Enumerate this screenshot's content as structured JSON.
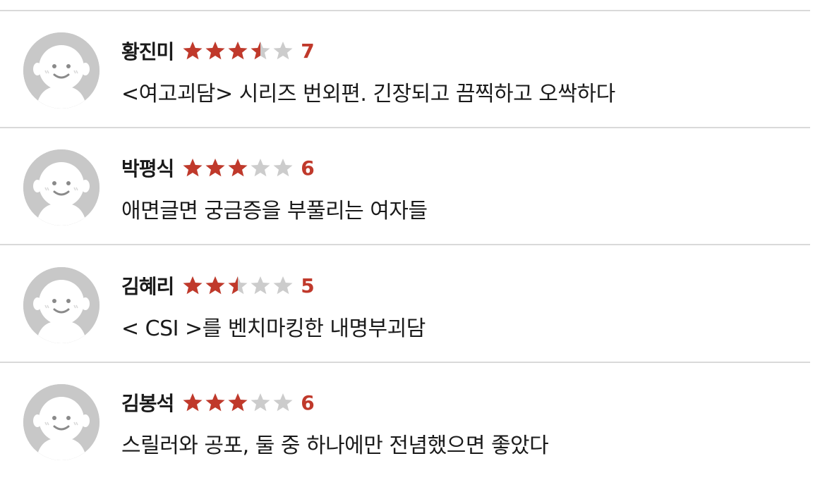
{
  "colors": {
    "star_filled": "#c0392b",
    "star_empty": "#cccccc",
    "score": "#c0392b",
    "avatar_bg": "#c8c8c8",
    "divider": "#d9d9d9"
  },
  "icons": {
    "avatar": "default-user-avatar-icon",
    "star": "star-icon"
  },
  "reviews": [
    {
      "name": "황진미",
      "stars": 3.5,
      "score": "7",
      "comment": "<여고괴담> 시리즈 번외편. 긴장되고 끔찍하고 오싹하다"
    },
    {
      "name": "박평식",
      "stars": 3,
      "score": "6",
      "comment": "애면글면 궁금증을 부풀리는 여자들"
    },
    {
      "name": "김혜리",
      "stars": 2.5,
      "score": "5",
      "comment": "< CSI >를 벤치마킹한 내명부괴담"
    },
    {
      "name": "김봉석",
      "stars": 3,
      "score": "6",
      "comment": "스릴러와 공포, 둘 중 하나에만 전념했으면 좋았다"
    }
  ]
}
